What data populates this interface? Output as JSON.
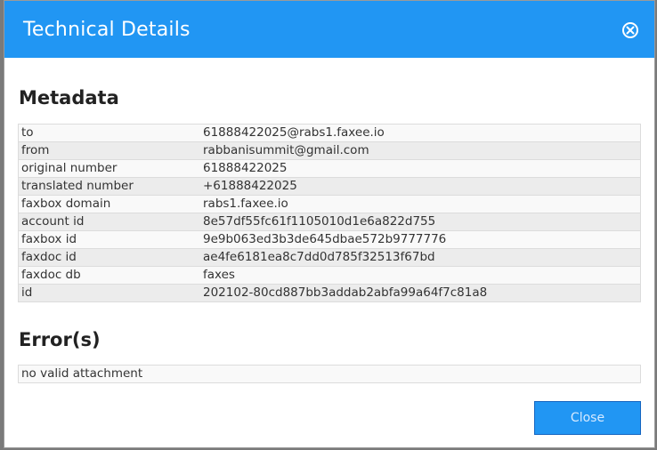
{
  "dialog": {
    "title": "Technical Details",
    "close_button_label": "Close"
  },
  "metadata": {
    "heading": "Metadata",
    "rows": [
      {
        "key": "to",
        "value": "61888422025@rabs1.faxee.io"
      },
      {
        "key": "from",
        "value": "rabbanisummit@gmail.com"
      },
      {
        "key": "original number",
        "value": "61888422025"
      },
      {
        "key": "translated number",
        "value": "+61888422025"
      },
      {
        "key": "faxbox domain",
        "value": "rabs1.faxee.io"
      },
      {
        "key": "account id",
        "value": "8e57df55fc61f1105010d1e6a822d755"
      },
      {
        "key": "faxbox id",
        "value": "9e9b063ed3b3de645dbae572b9777776"
      },
      {
        "key": "faxdoc id",
        "value": "ae4fe6181ea8c7dd0d785f32513f67bd"
      },
      {
        "key": "faxdoc db",
        "value": "faxes"
      },
      {
        "key": "id",
        "value": "202102-80cd887bb3addab2abfa99a64f7c81a8"
      }
    ]
  },
  "errors": {
    "heading": "Error(s)",
    "items": [
      "no valid attachment"
    ]
  },
  "colors": {
    "header": "#2196f3",
    "button": "#2196f3"
  }
}
